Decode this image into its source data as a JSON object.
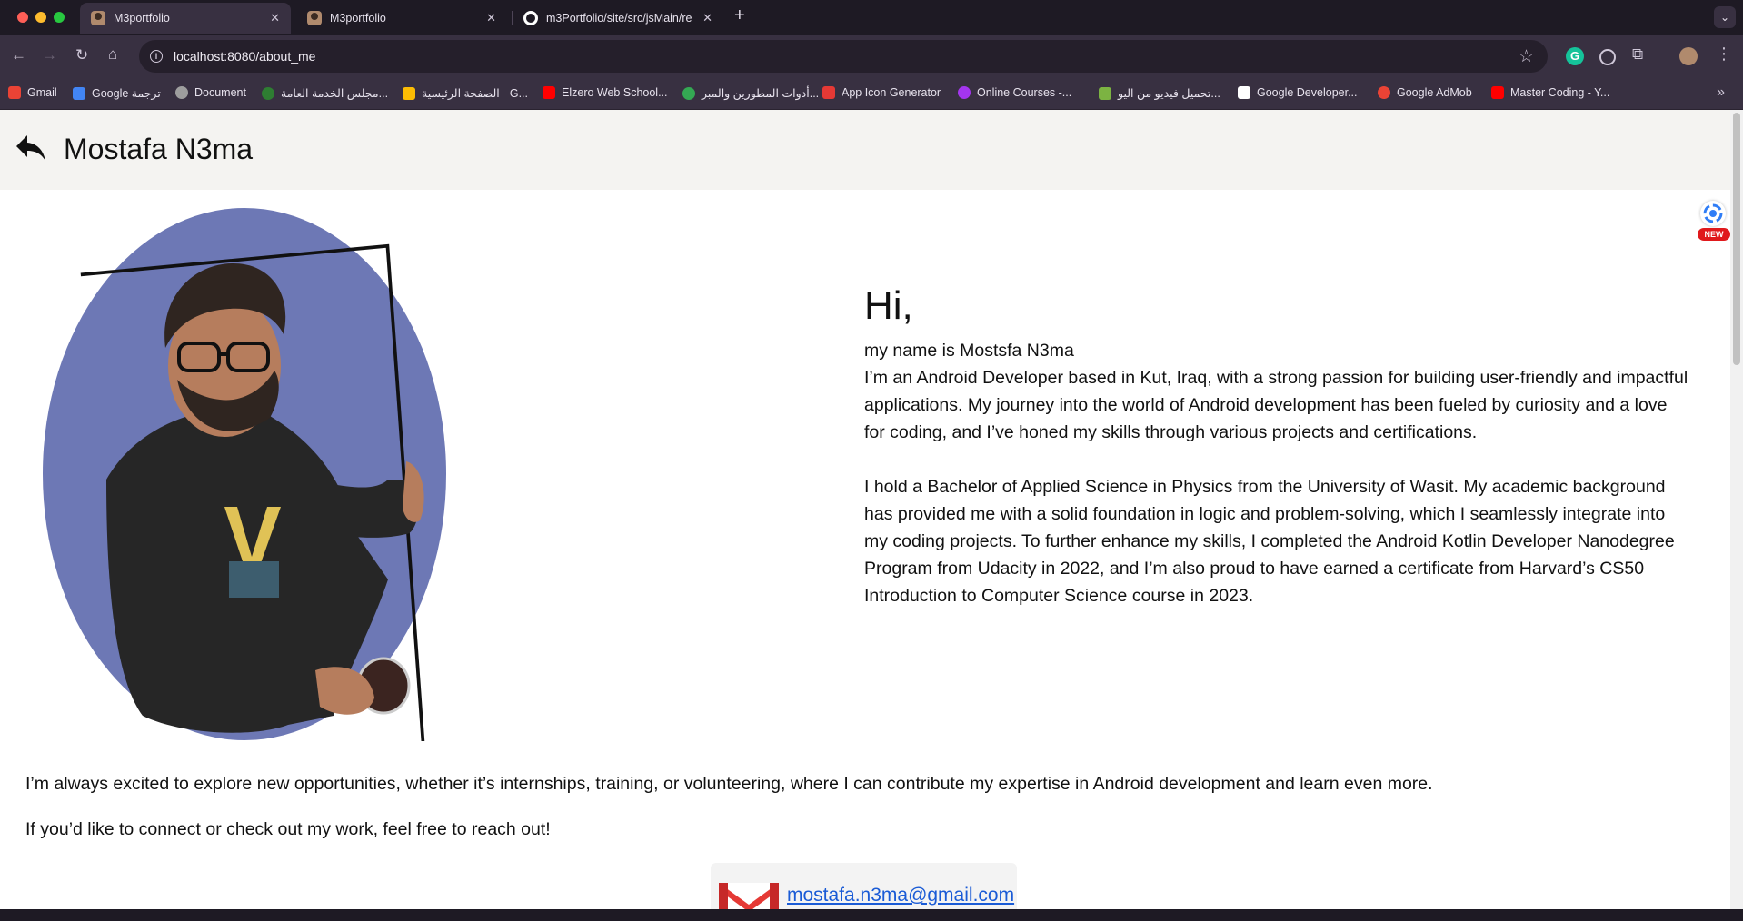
{
  "browser": {
    "tabs": [
      {
        "title": "M3portfolio",
        "icon": "profile-favicon",
        "active": true
      },
      {
        "title": "M3portfolio",
        "icon": "profile-favicon",
        "active": false
      },
      {
        "title": "m3Portfolio/site/src/jsMain/re",
        "icon": "github-icon",
        "active": false
      }
    ],
    "new_tab": "+",
    "address": "localhost:8080/about_me",
    "bookmarks": [
      {
        "label": "Gmail",
        "icon": "gmail-icon",
        "color": "#ea4335"
      },
      {
        "label": "Google ترجمة",
        "icon": "translate-icon",
        "color": "#4285f4"
      },
      {
        "label": "Document",
        "icon": "globe-icon",
        "color": "#9e9e9e"
      },
      {
        "label": "مجلس الخدمة العامة...",
        "icon": "seal-icon",
        "color": "#2e7d32"
      },
      {
        "label": "الصفحة الرئيسية - G...",
        "icon": "ads-icon",
        "color": "#fbbc04"
      },
      {
        "label": "Elzero Web School...",
        "icon": "youtube-icon",
        "color": "#ff0000"
      },
      {
        "label": "أدوات المطورين والمبر...",
        "icon": "dev-tools-icon",
        "color": "#34a853"
      },
      {
        "label": "App Icon Generator",
        "icon": "grid-icon",
        "color": "#e53935"
      },
      {
        "label": "Online Courses -...",
        "icon": "udemy-icon",
        "color": "#a435f0"
      },
      {
        "label": "تحميل فيديو من اليو...",
        "icon": "download-icon",
        "color": "#7cb342"
      },
      {
        "label": "Google Developer...",
        "icon": "google-dev-icon",
        "color": "#ffffff"
      },
      {
        "label": "Google AdMob",
        "icon": "admob-icon",
        "color": "#ea4335"
      },
      {
        "label": "Master Coding - Y...",
        "icon": "youtube-icon",
        "color": "#ff0000"
      }
    ]
  },
  "page": {
    "title": "Mostafa N3ma",
    "greeting": "Hi,",
    "name_line": "my name is Mostsfa N3ma",
    "paragraph_1": "I’m an Android Developer based in Kut, Iraq, with a strong passion for building user-friendly and impactful applications. My journey into the world of Android development has been fueled by curiosity and a love for coding, and I’ve honed my skills through various projects and certifications.",
    "paragraph_2": "I hold a Bachelor of Applied Science in Physics from the University of Wasit. My academic background has provided me with a solid foundation in logic and problem-solving, which I seamlessly integrate into my coding projects. To further enhance my skills, I completed the Android Kotlin Developer Nanodegree Program from Udacity in 2022, and I’m also proud to have earned a certificate from Harvard’s CS50 Introduction to Computer Science course in 2023.",
    "opportunities": "I’m always excited to explore new opportunities, whether it’s internships, training, or volunteering, where I can contribute my expertise in Android development and learn even more.",
    "reach_out": "If you’d like to connect or check out my work, feel free to reach out!",
    "email": "mostafa.n3ma@gmail.com",
    "side_badge": "NEW"
  },
  "colors": {
    "portrait_oval": "#6d78b5",
    "app_bar": "#f4f3f1",
    "link": "#1a5bd6",
    "browser_frame": "#1e1a24"
  }
}
